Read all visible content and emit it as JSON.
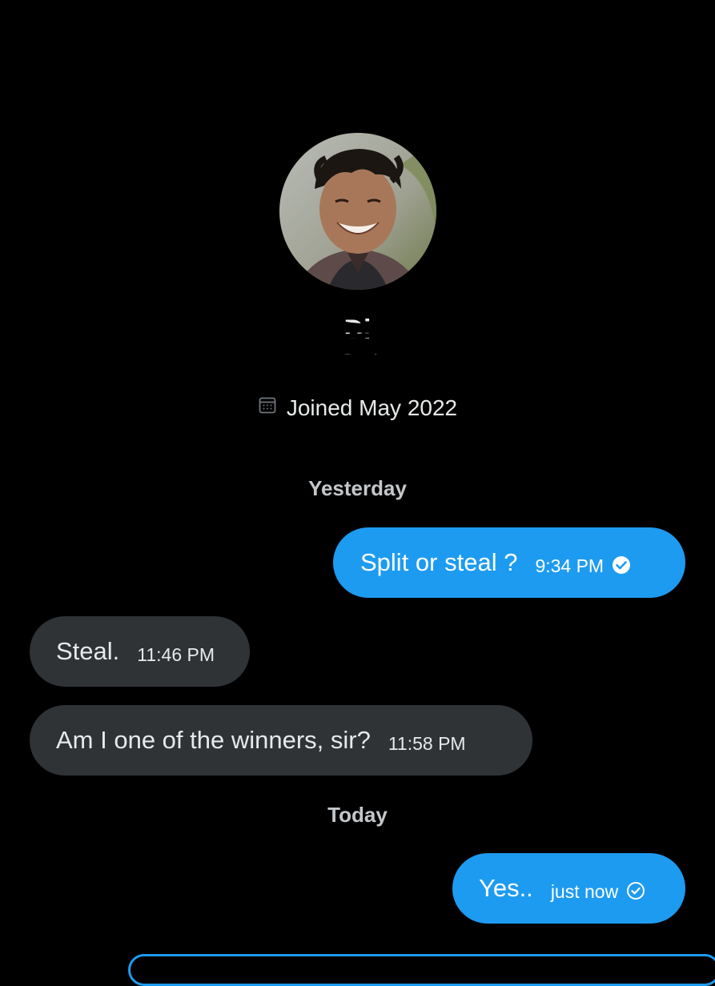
{
  "profile": {
    "avatar_icon": "avatar-photo",
    "display_name": "Di",
    "handle": "@Di",
    "joined_text": "Joined May 2022",
    "joined_icon": "calendar-icon"
  },
  "conversation": {
    "separators": [
      "Yesterday",
      "Today"
    ],
    "messages": [
      {
        "direction": "sent",
        "text": "Split or steal ?",
        "time": "9:34 PM",
        "status": "read"
      },
      {
        "direction": "received",
        "text": "Steal.",
        "time": "11:46 PM"
      },
      {
        "direction": "received",
        "text": "Am I one of the winners, sir?",
        "time": "11:58 PM"
      },
      {
        "direction": "sent",
        "text": "Yes..",
        "time": "just now",
        "status": "sent"
      }
    ]
  },
  "colors": {
    "background": "#000000",
    "sent_bubble": "#1d9bf0",
    "received_bubble": "#2f3336",
    "muted_text": "#71767b"
  }
}
